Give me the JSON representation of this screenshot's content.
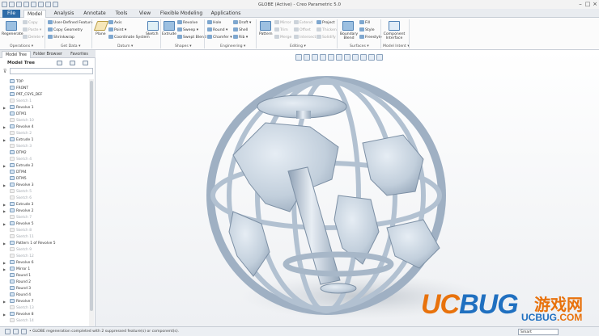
{
  "window": {
    "title": "GLOBE (Active) - Creo Parametric 5.0",
    "minimize": "–",
    "maximize": "□",
    "close": "×"
  },
  "tabs": [
    "File",
    "Model",
    "Analysis",
    "Annotate",
    "Tools",
    "View",
    "Flexible Modeling",
    "Applications"
  ],
  "active_tab": "Model",
  "ribbon": {
    "operations": {
      "label": "Operations ▾",
      "regenerate": "Regenerate",
      "copy": "Copy",
      "paste": "Paste ▾",
      "delete": "Delete ▾"
    },
    "get_data": {
      "label": "Get Data ▾",
      "user_defined_feature": "User-Defined Feature",
      "copy_geometry": "Copy Geometry",
      "shrinkwrap": "Shrinkwrap"
    },
    "datum": {
      "label": "Datum ▾",
      "plane": "Plane",
      "axis": "Axis",
      "point": "Point ▾",
      "coordinate_system": "Coordinate System",
      "sketch": "Sketch"
    },
    "shapes": {
      "label": "Shapes ▾",
      "extrude": "Extrude",
      "revolve": "Revolve",
      "sweep": "Sweep ▾",
      "swept_blend": "Swept Blend"
    },
    "engineering": {
      "label": "Engineering ▾",
      "hole": "Hole",
      "round": "Round ▾",
      "chamfer": "Chamfer ▾",
      "draft": "Draft ▾",
      "shell": "Shell",
      "rib": "Rib ▾"
    },
    "editing": {
      "label": "Editing ▾",
      "pattern": "Pattern",
      "mirror": "Mirror",
      "trim": "Trim",
      "merge": "Merge",
      "extend": "Extend",
      "offset": "Offset",
      "intersect": "Intersect",
      "project": "Project",
      "thicken": "Thicken",
      "solidify": "Solidify"
    },
    "surfaces": {
      "label": "Surfaces ▾",
      "boundary_blend": "Boundary Blend",
      "fill": "Fill",
      "style": "Style",
      "freestyle": "Freestyle"
    },
    "model_intent": {
      "label": "Model Intent ▾",
      "component_interface": "Component Interface"
    }
  },
  "panel": {
    "tabs": [
      "Model Tree",
      "Folder Browser",
      "Favorites"
    ],
    "title": "Model Tree",
    "search_placeholder": "",
    "items": [
      {
        "label": "TOP",
        "suppressed": false,
        "expandable": false
      },
      {
        "label": "FRONT",
        "suppressed": false,
        "expandable": false
      },
      {
        "label": "PRT_CSYS_DEF",
        "suppressed": false,
        "expandable": false
      },
      {
        "label": "Sketch 1",
        "suppressed": true,
        "expandable": false
      },
      {
        "label": "Revolve 1",
        "suppressed": false,
        "expandable": true
      },
      {
        "label": "DTM1",
        "suppressed": false,
        "expandable": false
      },
      {
        "label": "Sketch 10",
        "suppressed": true,
        "expandable": false
      },
      {
        "label": "Revolve 4",
        "suppressed": false,
        "expandable": true
      },
      {
        "label": "Sketch 2",
        "suppressed": true,
        "expandable": false
      },
      {
        "label": "Extrude 1",
        "suppressed": false,
        "expandable": true
      },
      {
        "label": "Sketch 3",
        "suppressed": true,
        "expandable": false
      },
      {
        "label": "DTM2",
        "suppressed": false,
        "expandable": false
      },
      {
        "label": "Sketch 4",
        "suppressed": true,
        "expandable": false
      },
      {
        "label": "Extrude 2",
        "suppressed": false,
        "expandable": true
      },
      {
        "label": "DTM4",
        "suppressed": false,
        "expandable": false
      },
      {
        "label": "DTM5",
        "suppressed": false,
        "expandable": false
      },
      {
        "label": "Revolve 3",
        "suppressed": false,
        "expandable": true
      },
      {
        "label": "Sketch 5",
        "suppressed": true,
        "expandable": false
      },
      {
        "label": "Sketch 6",
        "suppressed": true,
        "expandable": false
      },
      {
        "label": "Extrude 3",
        "suppressed": false,
        "expandable": true
      },
      {
        "label": "Revolve 2",
        "suppressed": false,
        "expandable": true
      },
      {
        "label": "Sketch 7",
        "suppressed": true,
        "expandable": false
      },
      {
        "label": "Revolve 5",
        "suppressed": false,
        "expandable": true
      },
      {
        "label": "Sketch 8",
        "suppressed": true,
        "expandable": false
      },
      {
        "label": "Sketch 11",
        "suppressed": true,
        "expandable": false
      },
      {
        "label": "Pattern 1 of Revolve 5",
        "suppressed": false,
        "expandable": true
      },
      {
        "label": "Sketch 9",
        "suppressed": true,
        "expandable": false
      },
      {
        "label": "Sketch 12",
        "suppressed": true,
        "expandable": false
      },
      {
        "label": "Revolve 6",
        "suppressed": false,
        "expandable": true
      },
      {
        "label": "Mirror 1",
        "suppressed": false,
        "expandable": true
      },
      {
        "label": "Round 1",
        "suppressed": false,
        "expandable": false
      },
      {
        "label": "Round 2",
        "suppressed": false,
        "expandable": false
      },
      {
        "label": "Round 3",
        "suppressed": false,
        "expandable": false
      },
      {
        "label": "Round 4",
        "suppressed": false,
        "expandable": false
      },
      {
        "label": "Revolve 7",
        "suppressed": false,
        "expandable": true
      },
      {
        "label": "Sketch 13",
        "suppressed": true,
        "expandable": false
      },
      {
        "label": "Revolve 8",
        "suppressed": false,
        "expandable": true
      },
      {
        "label": "Sketch 14",
        "suppressed": true,
        "expandable": false
      }
    ]
  },
  "status": {
    "message": "• GLOBE regeneration completed with 2 suppressed feature(s) or component(s).",
    "selection_filter": "Smart"
  },
  "watermark": {
    "brand_a": "UC",
    "brand_b": "BUG",
    "brand_c": "游戏网",
    "domain": ".COM"
  },
  "colors": {
    "accent": "#2f6ca8",
    "model": "#c7d3df",
    "model_shadow": "#8a9bb0"
  }
}
